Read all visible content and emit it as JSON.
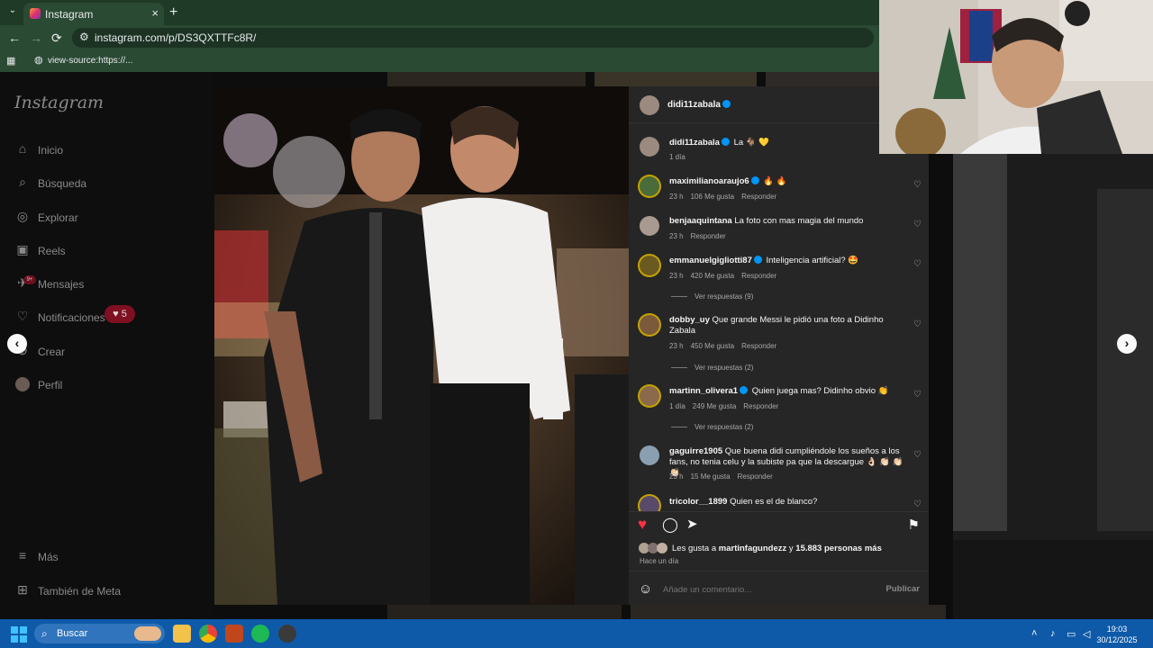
{
  "browser": {
    "tab_title": "Instagram",
    "tab_close": "×",
    "new_tab": "+",
    "url": "instagram.com/p/DS3QXTTFc8R/",
    "bookmark_label": "view-source:https://...",
    "back": "←",
    "forward": "→",
    "reload": "⟳"
  },
  "sidebar": {
    "logo": "Instagram",
    "items": [
      {
        "label": "Inicio",
        "icon": "home-icon",
        "glyph": "⌂"
      },
      {
        "label": "Búsqueda",
        "icon": "search-icon",
        "glyph": "⌕"
      },
      {
        "label": "Explorar",
        "icon": "compass-icon",
        "glyph": "◎"
      },
      {
        "label": "Reels",
        "icon": "reels-icon",
        "glyph": "▣"
      },
      {
        "label": "Mensajes",
        "icon": "messenger-icon",
        "glyph": "✈"
      },
      {
        "label": "Notificaciones",
        "icon": "heart-icon",
        "glyph": "♡"
      },
      {
        "label": "Crear",
        "icon": "plus-icon",
        "glyph": "⊕"
      },
      {
        "label": "Perfil",
        "icon": "avatar-icon",
        "glyph": "●"
      },
      {
        "label": "Más",
        "icon": "menu-icon",
        "glyph": "≡"
      },
      {
        "label": "También de Meta",
        "icon": "meta-icon",
        "glyph": "⊞"
      }
    ],
    "notif_badge": "♥ 5",
    "msg_badge": "9+"
  },
  "post": {
    "author": "didi11zabala",
    "caption_user": "didi11zabala",
    "caption_text": "La 🐐 💛",
    "caption_time": "1 día"
  },
  "comments": [
    {
      "user": "maximilianoaraujo6",
      "verified": true,
      "text": "🔥 🔥",
      "time": "23 h",
      "likes": "106 Me gusta",
      "reply": "Responder"
    },
    {
      "user": "benjaaquintana",
      "verified": false,
      "text": "La foto con mas magia del mundo",
      "time": "23 h",
      "likes": "",
      "reply": "Responder"
    },
    {
      "user": "emmanuelgigliotti87",
      "verified": true,
      "text": "Inteligencia artificial? 🤩",
      "time": "23 h",
      "likes": "420 Me gusta",
      "reply": "Responder",
      "view_replies": "Ver respuestas (9)"
    },
    {
      "user": "dobby_uy",
      "verified": false,
      "text": "Que grande Messi le pidió una foto a Didinho Zabala",
      "time": "23 h",
      "likes": "450 Me gusta",
      "reply": "Responder",
      "view_replies": "Ver respuestas (2)"
    },
    {
      "user": "martinn_olivera1",
      "verified": true,
      "text": "Quien juega mas? Didinho obvio 👏",
      "time": "1 día",
      "likes": "249 Me gusta",
      "reply": "Responder",
      "view_replies": "Ver respuestas (2)"
    },
    {
      "user": "gaguirre1905",
      "verified": false,
      "text": "Que buena didi cumpliéndole los sueños a los fans, no tenia celu y la subiste pa que la descargue 👌🏻 👏🏻 👏🏻 👏🏻",
      "time": "23 h",
      "likes": "15 Me gusta",
      "reply": "Responder"
    },
    {
      "user": "tricolor__1899",
      "verified": false,
      "text": "Quien es el de blanco?",
      "time": "",
      "likes": "",
      "reply": ""
    }
  ],
  "likes_line": {
    "prefix": "Les gusta a ",
    "user": "martinfagundezz",
    "mid": " y ",
    "count": "15.883 personas más"
  },
  "post_time": "Hace un día",
  "comment_box": {
    "placeholder": "Añade un comentario...",
    "publish": "Publicar"
  },
  "taskbar": {
    "search_label": "Buscar",
    "time": "19:03",
    "date": "30/12/2025"
  },
  "colors": {
    "browser_frame": "#2a4a33",
    "panel_bg": "#262626",
    "like_red": "#ff3040",
    "taskbar": "#0e5aa8"
  }
}
